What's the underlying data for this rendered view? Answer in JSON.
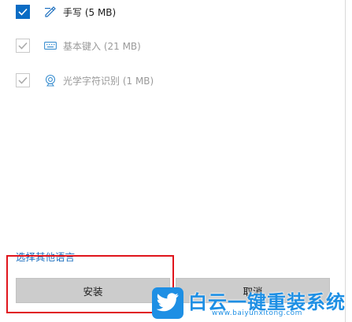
{
  "options": [
    {
      "label": "手写 (5 MB)",
      "checked": true,
      "enabled": true,
      "icon": "pen-icon"
    },
    {
      "label": "基本键入 (21 MB)",
      "checked": true,
      "enabled": false,
      "icon": "keyboard-icon"
    },
    {
      "label": "光学字符识别 (1 MB)",
      "checked": true,
      "enabled": false,
      "icon": "ocr-camera-icon"
    }
  ],
  "choose_other_language_link": "选择其他语言",
  "install_button": "安装",
  "cancel_button": "取消",
  "watermark": {
    "title": "白云一键重装系统",
    "url": "www.baiyunxitong.com",
    "icon": "bird-icon"
  },
  "colors": {
    "accent": "#0a6cc4",
    "link": "#1c6fbf",
    "highlight_box": "#e0151c",
    "watermark": "#1e8fe4"
  }
}
